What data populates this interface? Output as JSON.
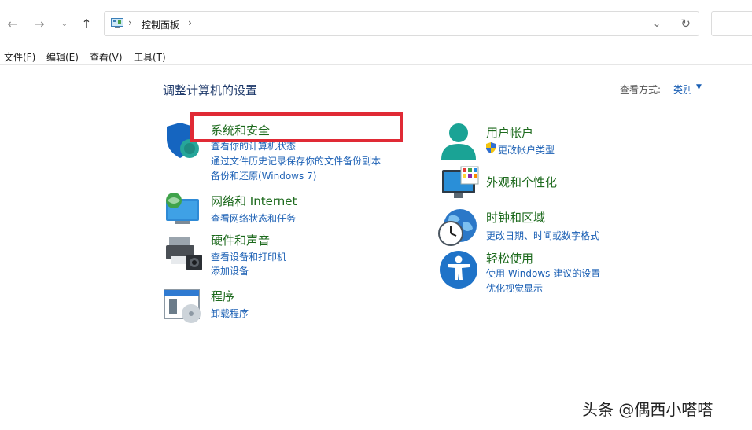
{
  "address_bar": {
    "breadcrumb": "控制面板",
    "separator": "›"
  },
  "menu": [
    "文件(F)",
    "编辑(E)",
    "查看(V)",
    "工具(T)"
  ],
  "content": {
    "heading": "调整计算机的设置",
    "view_by_label": "查看方式:",
    "view_by_value": "类别"
  },
  "categories": {
    "system_security": {
      "title": "系统和安全",
      "links": [
        "查看你的计算机状态",
        "通过文件历史记录保存你的文件备份副本",
        "备份和还原(Windows 7)"
      ]
    },
    "network": {
      "title": "网络和 Internet",
      "links": [
        "查看网络状态和任务"
      ]
    },
    "hardware": {
      "title": "硬件和声音",
      "links": [
        "查看设备和打印机",
        "添加设备"
      ]
    },
    "programs": {
      "title": "程序",
      "links": [
        "卸载程序"
      ]
    },
    "user_accounts": {
      "title": "用户帐户",
      "links": [
        "更改帐户类型"
      ]
    },
    "appearance": {
      "title": "外观和个性化",
      "links": []
    },
    "clock_region": {
      "title": "时钟和区域",
      "links": [
        "更改日期、时间或数字格式"
      ]
    },
    "ease_of_access": {
      "title": "轻松使用",
      "links": [
        "使用 Windows 建议的设置",
        "优化视觉显示"
      ]
    }
  },
  "watermark": "头条 @偶西小嗒嗒",
  "colors": {
    "title_green": "#1d6a1d",
    "link_blue": "#1a5fb4",
    "highlight_red": "#e02a35"
  }
}
